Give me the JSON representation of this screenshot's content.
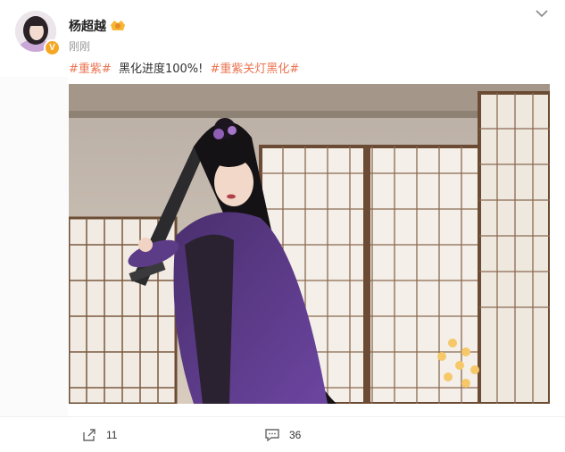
{
  "post": {
    "author": "杨超越",
    "timestamp": "刚刚",
    "tag1": "#重紫#",
    "body_text": "黑化进度100%!",
    "tag2": "#重紫关灯黑化#"
  },
  "actions": {
    "repost_count": "11",
    "comment_count": "36"
  },
  "colors": {
    "tag": "#eb7350",
    "verified_badge": "#f5a623",
    "text": "#333333",
    "muted": "#999999"
  },
  "icons": {
    "more": "chevron-down-icon",
    "repost": "repost-icon",
    "comment": "comment-icon",
    "verified": "verified-badge-icon",
    "user_badge": "fan-badge-icon"
  }
}
